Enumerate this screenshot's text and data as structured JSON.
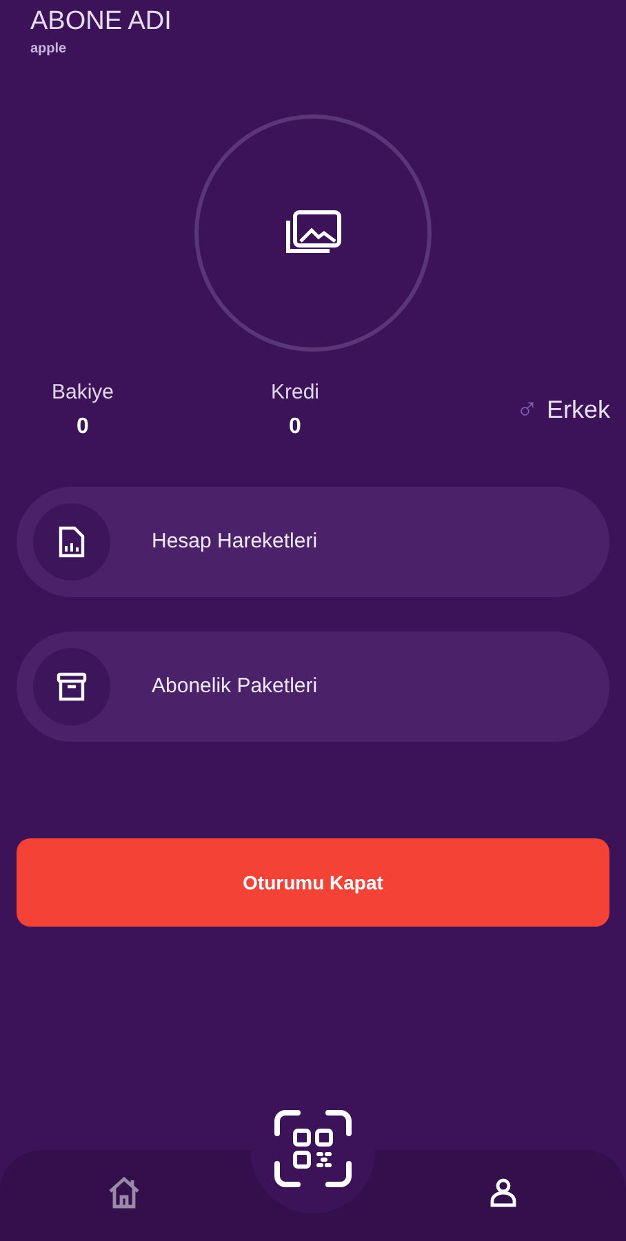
{
  "header": {
    "title": "ABONE ADI",
    "subtitle": "apple"
  },
  "stats": [
    {
      "label": "Bakiye",
      "value": "0"
    },
    {
      "label": "Kredi",
      "value": "0"
    }
  ],
  "gender": {
    "symbol": "♂",
    "label": "Erkek"
  },
  "menu": [
    {
      "kind": "statement",
      "label": "Hesap Hareketleri"
    },
    {
      "kind": "package",
      "label": "Abonelik Paketleri"
    }
  ],
  "logout_button": "Oturumu Kapat",
  "bottom_nav": [
    {
      "kind": "home",
      "selected": false
    },
    {
      "kind": "profile",
      "selected": true
    }
  ]
}
